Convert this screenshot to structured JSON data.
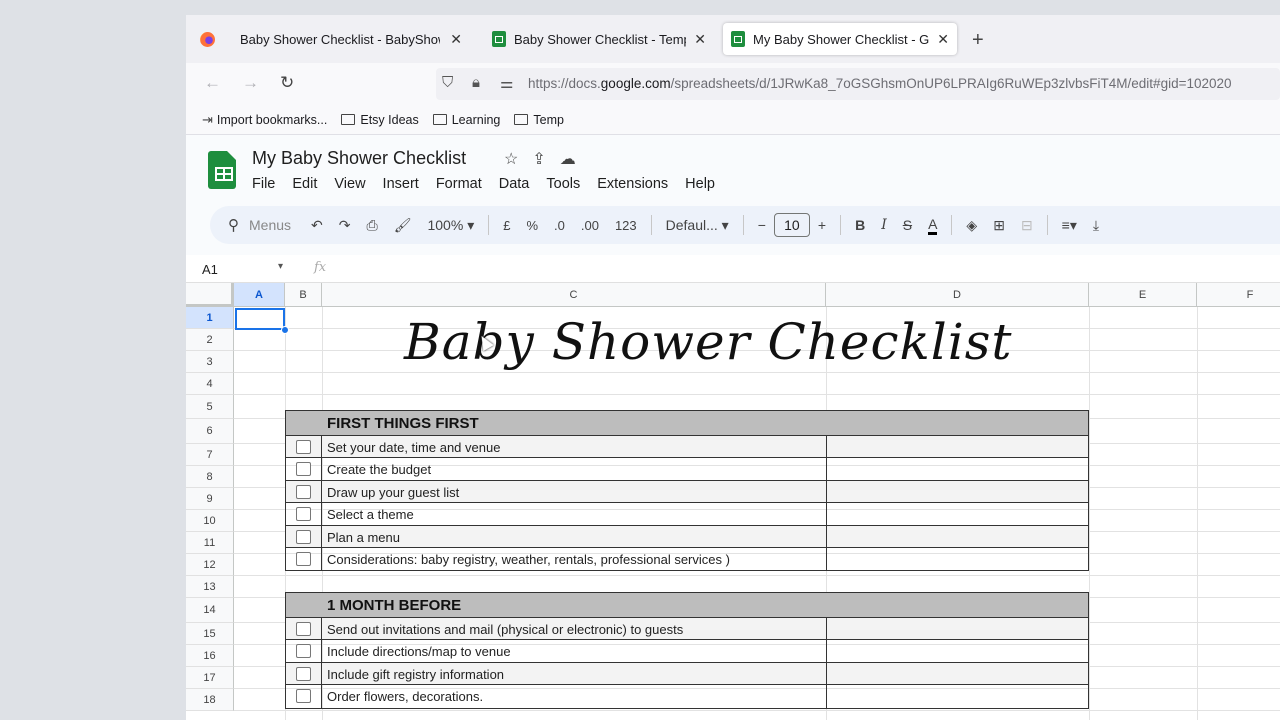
{
  "browser": {
    "tabs": [
      {
        "title": "Baby Shower Checklist - BabyShow",
        "favicon": "firefox-icon",
        "active": false
      },
      {
        "title": "Baby Shower Checklist - Templ",
        "favicon": "sheets-icon",
        "active": false
      },
      {
        "title": "My Baby Shower Checklist - Go",
        "favicon": "sheets-icon",
        "active": true
      }
    ],
    "close_glyph": "✕",
    "new_tab_glyph": "+",
    "nav": {
      "back": "←",
      "forward": "→",
      "reload": "↻"
    },
    "url": {
      "prefix": "https://docs.",
      "domain": "google.com",
      "path": "/spreadsheets/d/1JRwKa8_7oGSGhsmOnUP6LPRAIg6RuWEp3zlvbsFiT4M/edit#gid=102020"
    },
    "bookmarks": [
      {
        "label": "Import bookmarks...",
        "icon": "import-icon"
      },
      {
        "label": "Etsy Ideas",
        "icon": "folder-icon"
      },
      {
        "label": "Learning",
        "icon": "folder-icon"
      },
      {
        "label": "Temp",
        "icon": "folder-icon"
      }
    ]
  },
  "doc": {
    "title": "My Baby Shower Checklist",
    "title_icons": {
      "star": "☆",
      "move": "⇪",
      "cloud": "☁"
    },
    "menu": [
      "File",
      "Edit",
      "View",
      "Insert",
      "Format",
      "Data",
      "Tools",
      "Extensions",
      "Help"
    ]
  },
  "toolbar": {
    "search_icon": "⚲",
    "search_placeholder": "Menus",
    "undo": "↶",
    "redo": "↷",
    "print": "⎙",
    "paint_format": "🖌",
    "zoom": "100%",
    "currency": "£",
    "percent": "%",
    "dec_decrease": ".0",
    "dec_increase": ".00",
    "number_format": "123",
    "font": "Defaul...",
    "font_size_minus": "−",
    "font_size": "10",
    "font_size_plus": "+",
    "bold": "B",
    "italic": "I",
    "strike": "S",
    "text_color": "A",
    "fill": "◈",
    "borders": "⊞",
    "merge": "⊟",
    "align": "≡",
    "valign": "⤓",
    "dropdown": "▾"
  },
  "formula_bar": {
    "name_box": "A1",
    "fx": "fx",
    "value": ""
  },
  "sheet": {
    "columns": [
      "A",
      "B",
      "C",
      "D",
      "E",
      "F"
    ],
    "rows": [
      "1",
      "2",
      "3",
      "4",
      "5",
      "6",
      "7",
      "8",
      "9",
      "10",
      "11",
      "12",
      "13",
      "14",
      "15",
      "16",
      "17",
      "18"
    ],
    "selected_cell": "A1",
    "title": "Baby Shower Checklist",
    "sections": [
      {
        "heading": "FIRST THINGS FIRST",
        "items": [
          {
            "text": "Set your date, time and venue",
            "checked": false
          },
          {
            "text": "Create the budget",
            "checked": false
          },
          {
            "text": "Draw up your guest list",
            "checked": false
          },
          {
            "text": "Select a theme",
            "checked": false
          },
          {
            "text": "Plan a menu",
            "checked": false
          },
          {
            "text": "Considerations: baby registry, weather, rentals, professional services )",
            "checked": false
          }
        ]
      },
      {
        "heading": "1 MONTH BEFORE",
        "items": [
          {
            "text": "Send out invitations and mail (physical or electronic) to guests",
            "checked": false
          },
          {
            "text": "Include directions/map to venue",
            "checked": false
          },
          {
            "text": "Include gift registry information",
            "checked": false
          },
          {
            "text": "Order flowers, decorations.",
            "checked": false
          }
        ]
      }
    ]
  }
}
